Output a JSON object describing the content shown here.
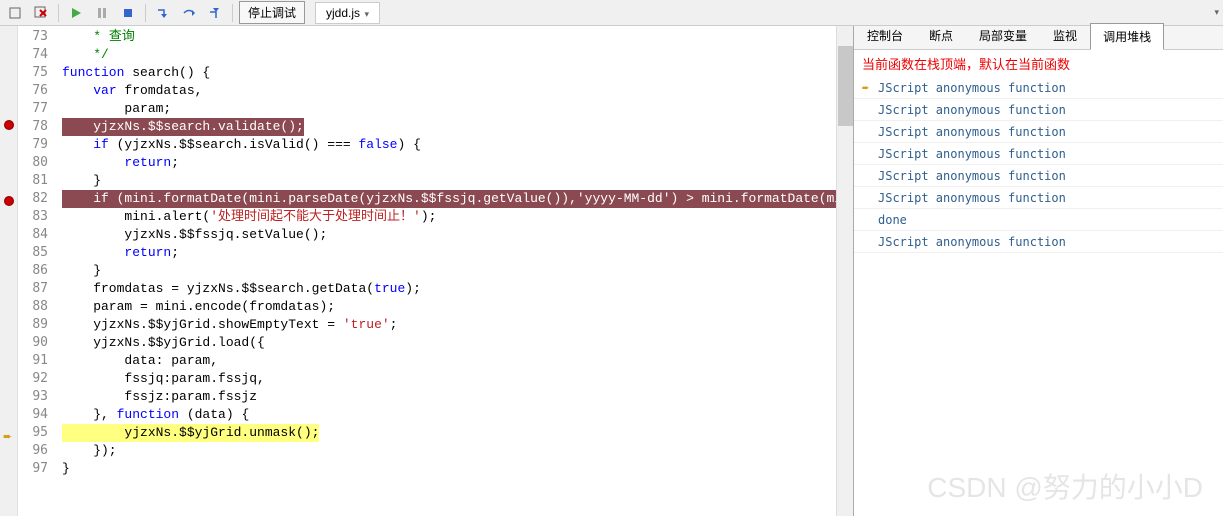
{
  "toolbar": {
    "stop_label": "停止调试",
    "file_tab": "yjdd.js"
  },
  "editor": {
    "lines": [
      {
        "n": 73,
        "segs": [
          {
            "t": "    * ",
            "c": "c-green"
          },
          {
            "t": "查询",
            "c": "c-green"
          }
        ]
      },
      {
        "n": 74,
        "segs": [
          {
            "t": "    */",
            "c": "c-green"
          }
        ]
      },
      {
        "n": 75,
        "segs": [
          {
            "t": "function",
            "c": "c-blue"
          },
          {
            "t": " search() {"
          }
        ]
      },
      {
        "n": 76,
        "segs": [
          {
            "t": "    "
          },
          {
            "t": "var",
            "c": "c-blue"
          },
          {
            "t": " fromdatas,"
          }
        ]
      },
      {
        "n": 77,
        "segs": [
          {
            "t": "        param;"
          }
        ]
      },
      {
        "n": 78,
        "bp": true,
        "hl": "dark",
        "segs": [
          {
            "t": "    yjzxNs.$$search.validate();"
          }
        ]
      },
      {
        "n": 79,
        "segs": [
          {
            "t": "    "
          },
          {
            "t": "if",
            "c": "c-blue"
          },
          {
            "t": " (yjzxNs.$$search.isValid() === "
          },
          {
            "t": "false",
            "c": "c-blue"
          },
          {
            "t": ") {"
          }
        ]
      },
      {
        "n": 80,
        "segs": [
          {
            "t": "        "
          },
          {
            "t": "return",
            "c": "c-blue"
          },
          {
            "t": ";"
          }
        ]
      },
      {
        "n": 81,
        "segs": [
          {
            "t": "    }"
          }
        ]
      },
      {
        "n": 82,
        "bp": true,
        "hl": "dark",
        "segs": [
          {
            "t": "    if (mini.formatDate(mini.parseDate(yjzxNs.$$fssjq.getValue()),'yyyy-MM-dd') > mini.formatDate(mini.parseDate("
          }
        ]
      },
      {
        "n": 83,
        "segs": [
          {
            "t": "        mini.alert("
          },
          {
            "t": "'处理时间起不能大于处理时间止！'",
            "c": "c-red"
          },
          {
            "t": ");"
          }
        ]
      },
      {
        "n": 84,
        "segs": [
          {
            "t": "        yjzxNs.$$fssjq.setValue();"
          }
        ]
      },
      {
        "n": 85,
        "segs": [
          {
            "t": "        "
          },
          {
            "t": "return",
            "c": "c-blue"
          },
          {
            "t": ";"
          }
        ]
      },
      {
        "n": 86,
        "segs": [
          {
            "t": "    }"
          }
        ]
      },
      {
        "n": 87,
        "segs": [
          {
            "t": "    fromdatas = yjzxNs.$$search.getData("
          },
          {
            "t": "true",
            "c": "c-blue"
          },
          {
            "t": ");"
          }
        ]
      },
      {
        "n": 88,
        "segs": [
          {
            "t": "    param = mini.encode(fromdatas);"
          }
        ]
      },
      {
        "n": 89,
        "segs": [
          {
            "t": "    yjzxNs.$$yjGrid.showEmptyText = "
          },
          {
            "t": "'true'",
            "c": "c-red"
          },
          {
            "t": ";"
          }
        ]
      },
      {
        "n": 90,
        "segs": [
          {
            "t": "    yjzxNs.$$yjGrid.load({"
          }
        ]
      },
      {
        "n": 91,
        "segs": [
          {
            "t": "        data: param,"
          }
        ]
      },
      {
        "n": 92,
        "segs": [
          {
            "t": "        fssjq:param.fssjq,"
          }
        ]
      },
      {
        "n": 93,
        "segs": [
          {
            "t": "        fssjz:param.fssjz"
          }
        ]
      },
      {
        "n": 94,
        "segs": [
          {
            "t": "    }, "
          },
          {
            "t": "function",
            "c": "c-blue"
          },
          {
            "t": " (data) {"
          }
        ]
      },
      {
        "n": 95,
        "arrow": true,
        "hl": "yellow",
        "segs": [
          {
            "t": "        yjzxNs.$$yjGrid.unmask();"
          }
        ]
      },
      {
        "n": 96,
        "segs": [
          {
            "t": "    });"
          }
        ]
      },
      {
        "n": 97,
        "segs": [
          {
            "t": "}"
          }
        ]
      }
    ]
  },
  "right": {
    "tabs": [
      "控制台",
      "断点",
      "局部变量",
      "监视",
      "调用堆栈"
    ],
    "active_tab": 4,
    "message": "当前函数在栈顶端，默认在当前函数",
    "stack": [
      {
        "label": "JScript anonymous function",
        "current": true
      },
      {
        "label": "JScript anonymous function"
      },
      {
        "label": "JScript anonymous function"
      },
      {
        "label": "JScript anonymous function"
      },
      {
        "label": "JScript anonymous function"
      },
      {
        "label": "JScript anonymous function"
      },
      {
        "label": "done"
      },
      {
        "label": "JScript anonymous function"
      }
    ]
  },
  "watermark": "CSDN @努力的小小D"
}
